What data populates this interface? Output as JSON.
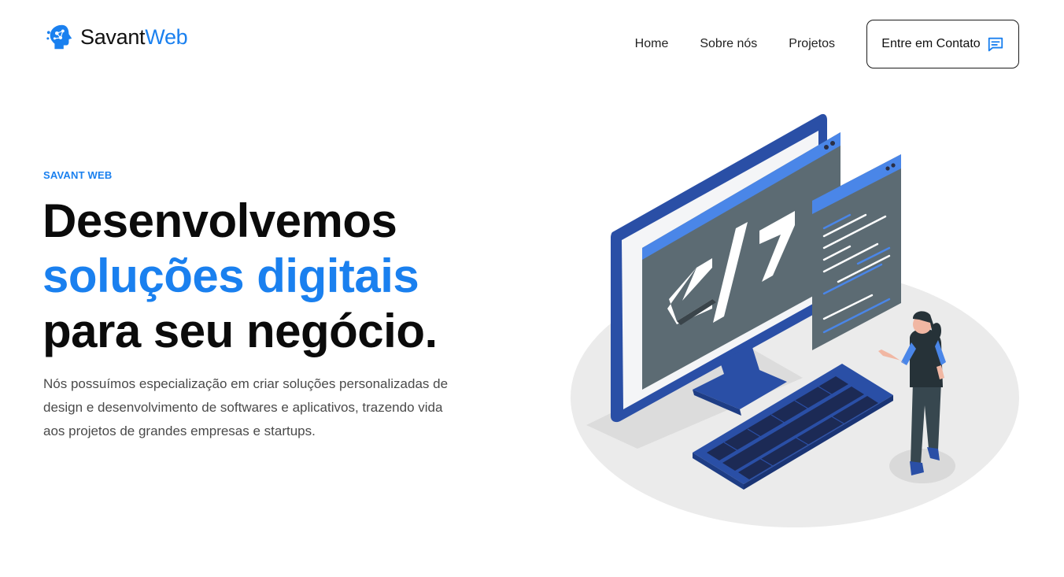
{
  "brand": {
    "name_part1": "Savant",
    "name_part2": "Web"
  },
  "nav": {
    "links": [
      "Home",
      "Sobre nós",
      "Projetos"
    ],
    "cta_label": "Entre em Contato"
  },
  "hero": {
    "eyebrow": "SAVANT WEB",
    "title_line1": "Desenvolvemos",
    "title_line2": "soluções digitais",
    "title_line3": "para seu negócio.",
    "description": "Nós possuímos especialização em criar soluções personalizadas de design e desenvolvimento de softwares e aplicativos, trazendo vida aos projetos de grandes empresas e startups."
  },
  "colors": {
    "accent": "#1a80ef",
    "illustration_blue": "#2a4fa6",
    "text": "#0b0b0b"
  },
  "icons": {
    "logo": "brain-network-icon",
    "cta": "chat-bubble-icon"
  }
}
